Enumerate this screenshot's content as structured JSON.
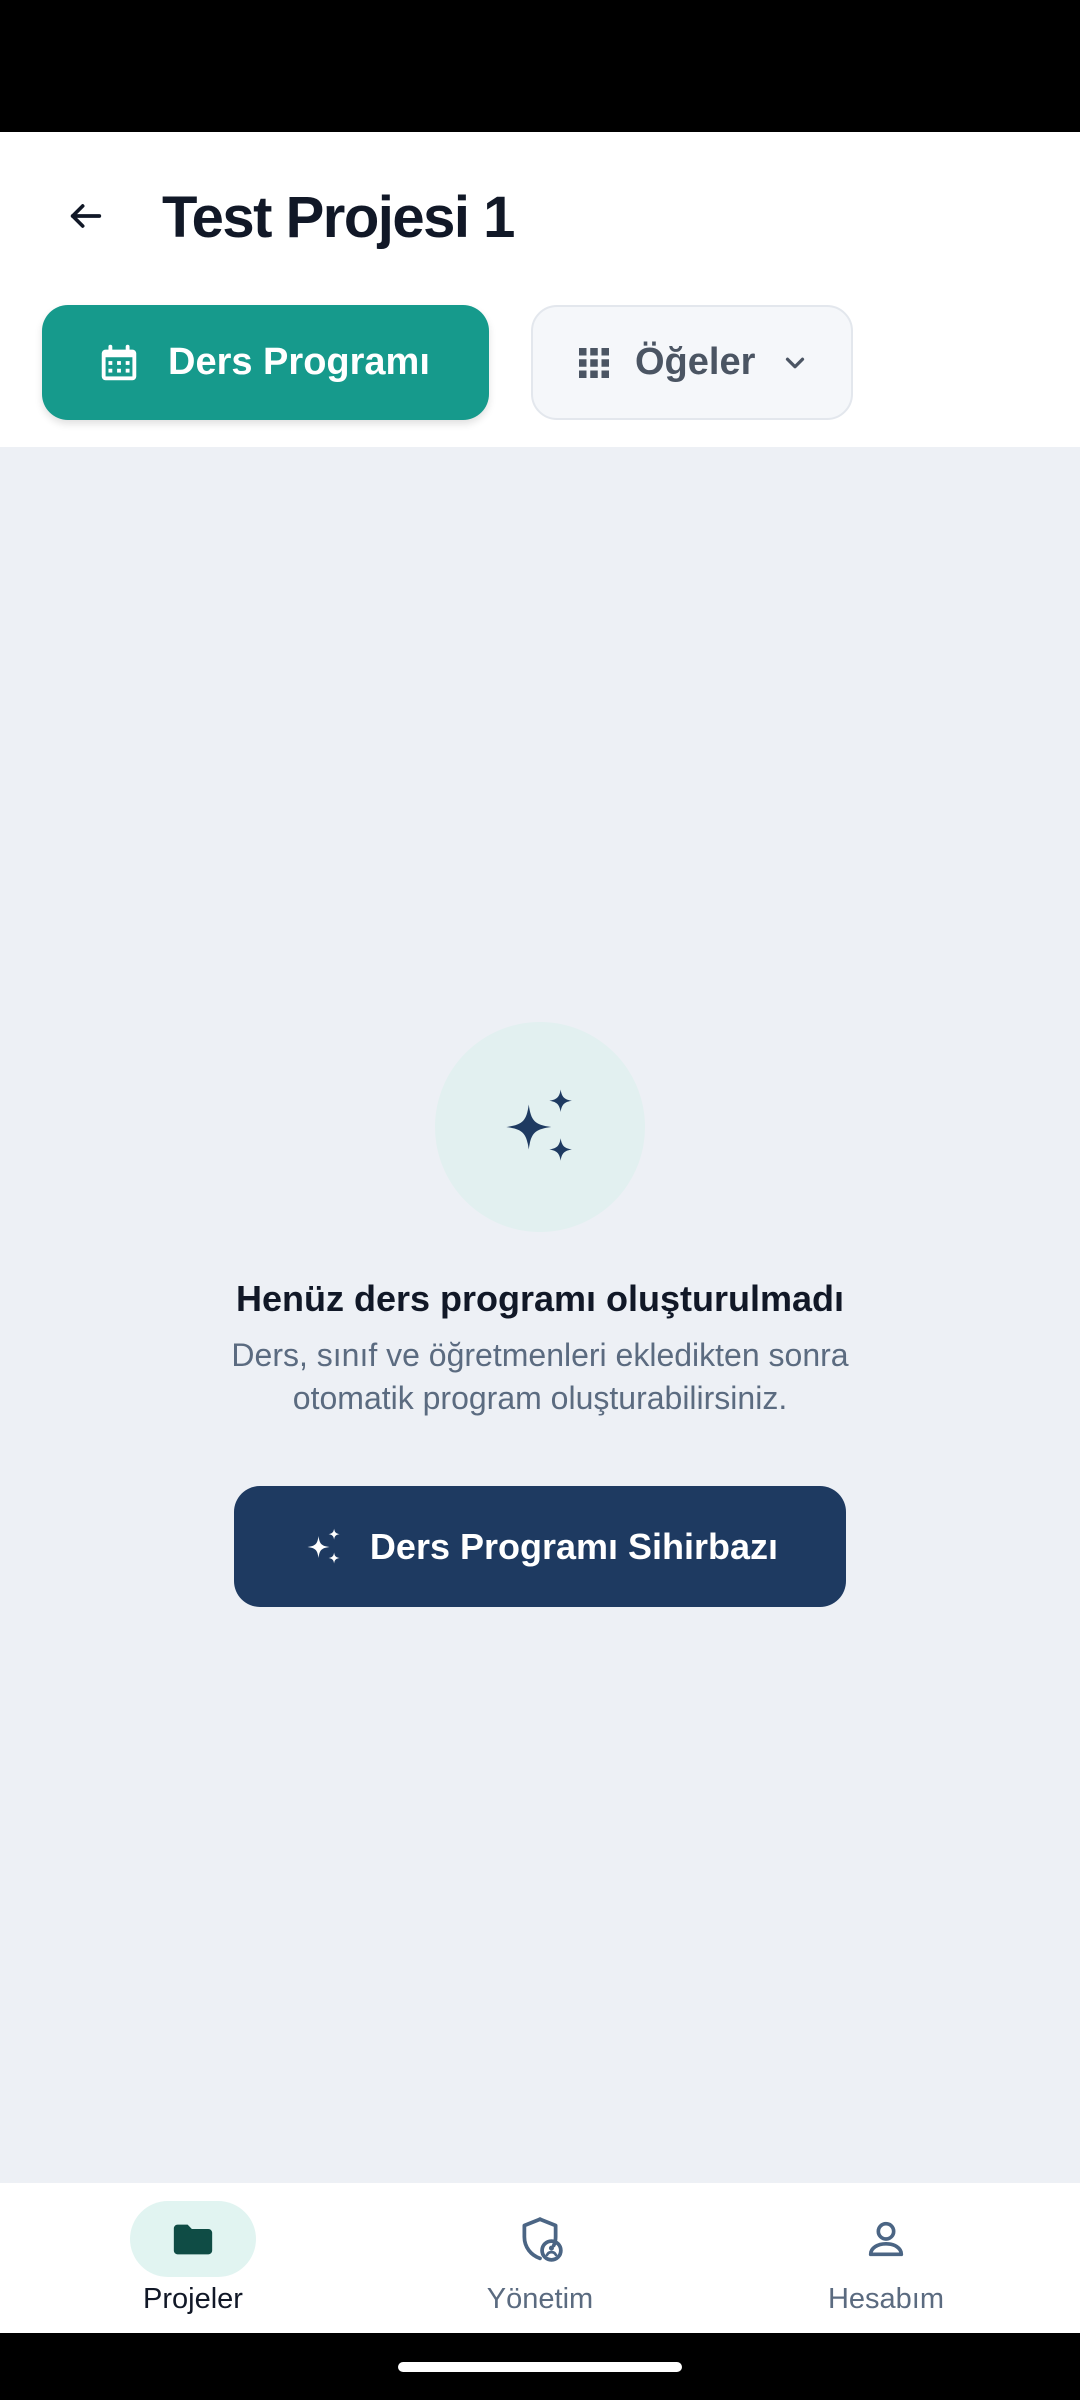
{
  "header": {
    "title": "Test Projesi 1",
    "back_icon": "arrow-left-icon"
  },
  "tabs": {
    "schedule": {
      "label": "Ders Programı",
      "icon": "calendar-icon"
    },
    "items": {
      "label": "Öğeler",
      "icon": "grid-icon",
      "dropdown_icon": "chevron-down-icon"
    }
  },
  "empty_state": {
    "icon": "sparkles-icon",
    "title": "Henüz ders programı oluşturulmadı",
    "description": "Ders, sınıf ve öğretmenleri ekledikten sonra otomatik program oluşturabilirsiniz."
  },
  "wizard_button": {
    "label": "Ders Programı Sihirbazı",
    "icon": "sparkles-icon"
  },
  "bottom_nav": {
    "items": [
      {
        "label": "Projeler",
        "icon": "folder-icon",
        "active": true
      },
      {
        "label": "Yönetim",
        "icon": "shield-user-icon",
        "active": false
      },
      {
        "label": "Hesabım",
        "icon": "person-icon",
        "active": false
      }
    ]
  },
  "colors": {
    "primary_teal": "#169a8c",
    "navy": "#1e3a61",
    "background": "#edf0f5",
    "text_dark": "#111827",
    "text_muted": "#5b6b80"
  }
}
